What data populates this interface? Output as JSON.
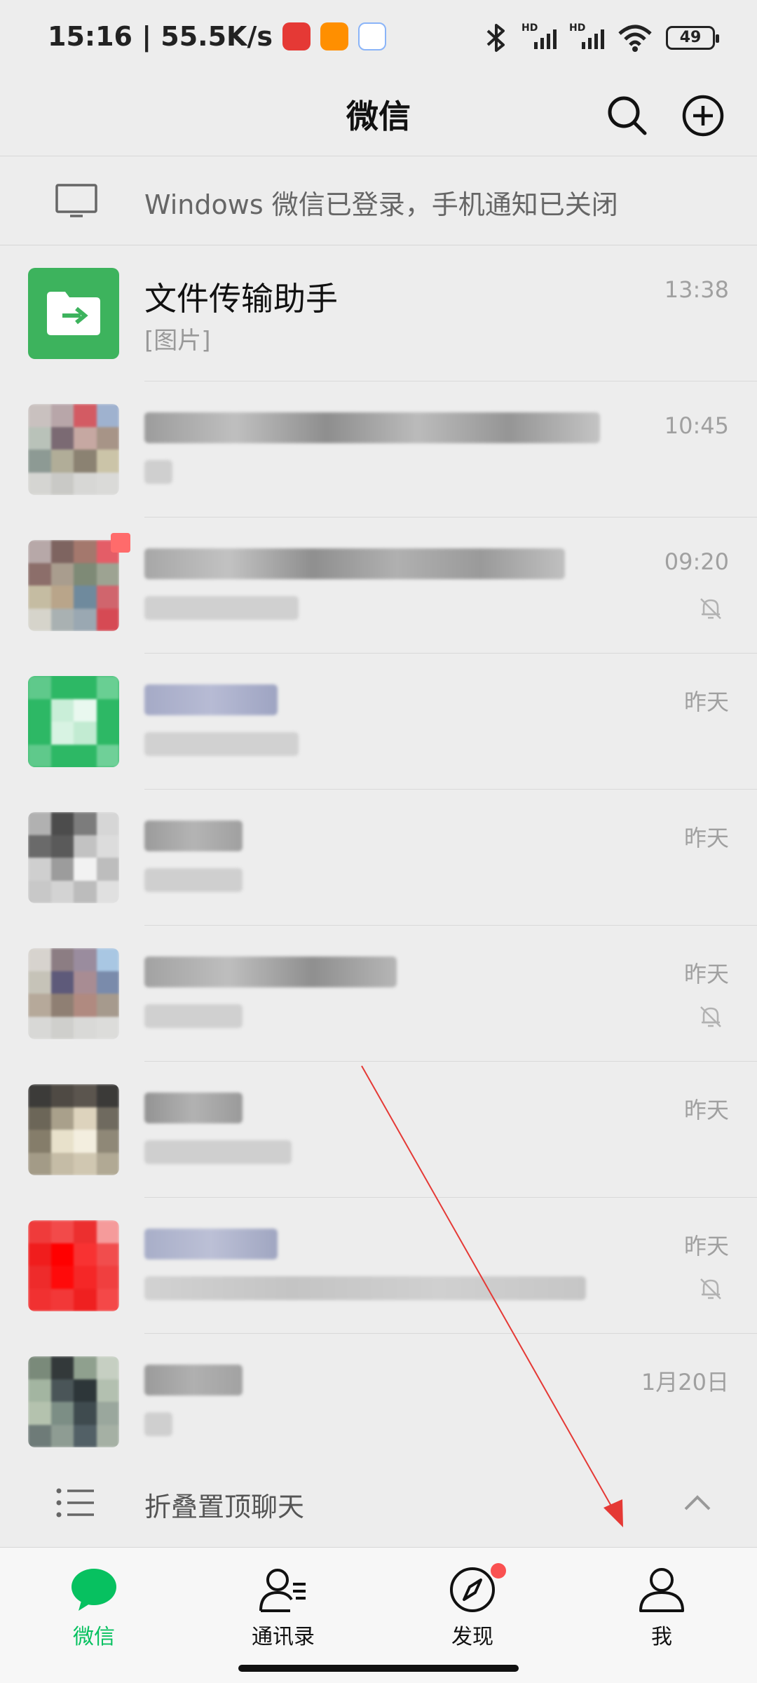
{
  "status_bar": {
    "time_speed": "15:16 | 55.5K/s",
    "hd_label": "HD",
    "battery": "49"
  },
  "header": {
    "title": "微信"
  },
  "notice": {
    "text": "Windows 微信已登录，手机通知已关闭"
  },
  "chats": [
    {
      "name": "文件传输助手",
      "preview": "[图片]",
      "time": "13:38",
      "muted": false
    },
    {
      "name": "",
      "preview": "",
      "time": "10:45",
      "muted": false
    },
    {
      "name": "",
      "preview": "",
      "time": "09:20",
      "muted": true
    },
    {
      "name": "",
      "preview": "",
      "time": "昨天",
      "muted": false
    },
    {
      "name": "",
      "preview": "",
      "time": "昨天",
      "muted": false
    },
    {
      "name": "",
      "preview": "",
      "time": "昨天",
      "muted": true
    },
    {
      "name": "",
      "preview": "",
      "time": "昨天",
      "muted": false
    },
    {
      "name": "",
      "preview": "",
      "time": "昨天",
      "muted": true
    },
    {
      "name": "",
      "preview": "",
      "time": "1月20日",
      "muted": false
    }
  ],
  "fold": {
    "label": "折叠置顶聊天"
  },
  "tabs": [
    {
      "label": "微信",
      "active": true
    },
    {
      "label": "通讯录",
      "active": false
    },
    {
      "label": "发现",
      "active": false,
      "badge": true
    },
    {
      "label": "我",
      "active": false
    }
  ],
  "colors": {
    "accent": "#07c160",
    "badge": "#fa5151",
    "file_helper": "#3db35d"
  }
}
